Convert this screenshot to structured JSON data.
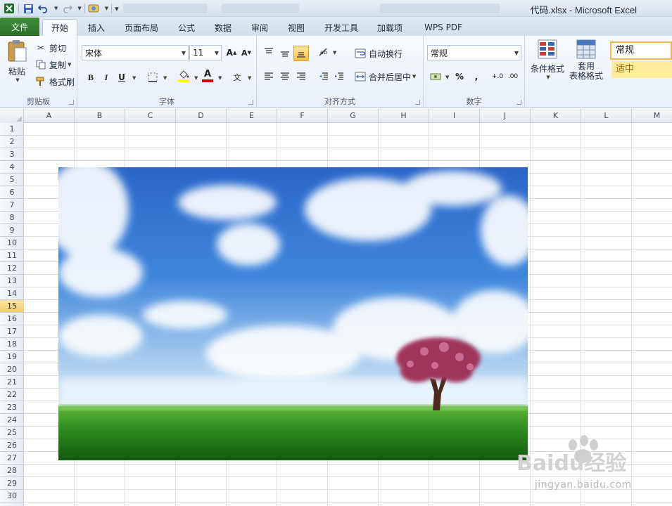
{
  "titlebar": {
    "title": "代码.xlsx  -  Microsoft Excel",
    "qat_customize_label": "▾"
  },
  "tabs": {
    "file": "文件",
    "items": [
      "开始",
      "插入",
      "页面布局",
      "公式",
      "数据",
      "审阅",
      "视图",
      "开发工具",
      "加载项",
      "WPS PDF"
    ],
    "active_index": 0
  },
  "ribbon": {
    "clipboard": {
      "label": "剪贴板",
      "paste": "粘贴",
      "cut": "剪切",
      "copy": "复制",
      "format_painter": "格式刷"
    },
    "font": {
      "label": "字体",
      "name": "宋体",
      "size": "11",
      "bold": "B",
      "italic": "I",
      "underline": "U"
    },
    "alignment": {
      "label": "对齐方式",
      "wrap_text": "自动换行",
      "merge_center": "合并后居中"
    },
    "number": {
      "label": "数字",
      "format": "常规",
      "percent": "%",
      "comma": ",",
      "inc_decimal": "+.0",
      "dec_decimal": ".00"
    },
    "styles": {
      "conditional_format": "条件格式",
      "format_table_line1": "套用",
      "format_table_line2": "表格格式",
      "style_normal": "常规",
      "style_neutral": "适中"
    }
  },
  "sheet": {
    "columns": [
      "A",
      "B",
      "C",
      "D",
      "E",
      "F",
      "G",
      "H",
      "I",
      "J",
      "K",
      "L",
      "M"
    ],
    "rows": [
      "1",
      "2",
      "3",
      "4",
      "5",
      "6",
      "7",
      "8",
      "9",
      "10",
      "11",
      "12",
      "13",
      "14",
      "15",
      "16",
      "17",
      "18",
      "19",
      "20",
      "21",
      "22",
      "23",
      "24",
      "25",
      "26",
      "27",
      "28",
      "29",
      "30"
    ],
    "selected_row": "15"
  },
  "watermark": {
    "brand": "Baidu经验",
    "url": "jingyan.baidu.com"
  },
  "colors": {
    "file_tab": "#2a6e27",
    "selected_row_header": "#f6cd6f",
    "neutral_style": "#ffeb9c"
  }
}
